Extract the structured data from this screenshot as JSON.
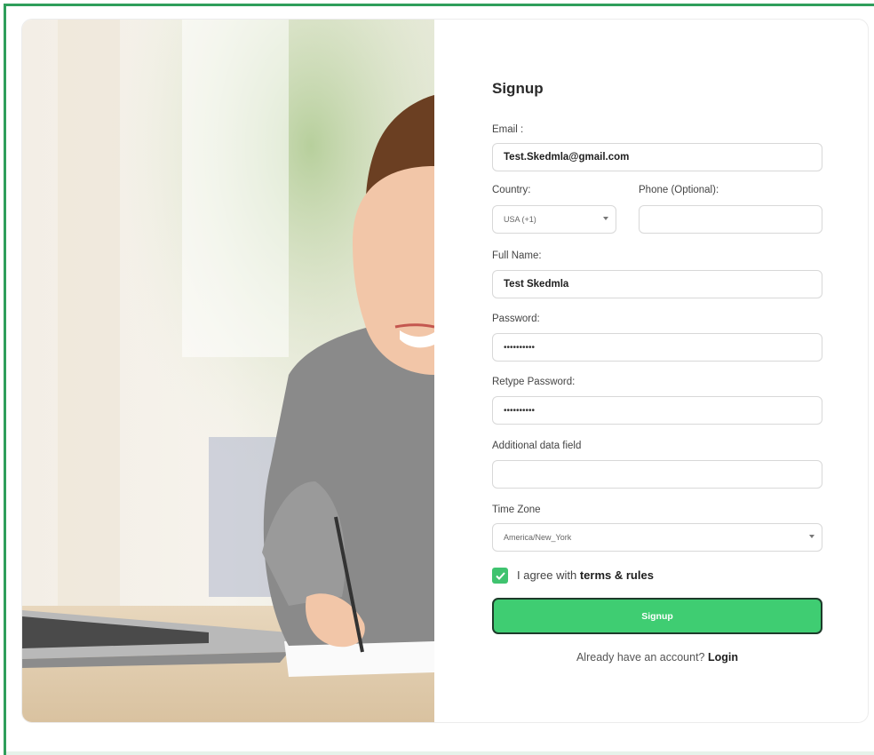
{
  "form": {
    "title": "Signup",
    "email_label": "Email :",
    "email_value": "Test.Skedmla@gmail.com",
    "country_label": "Country:",
    "country_value": "USA (+1)",
    "phone_label": "Phone (Optional):",
    "phone_value": "",
    "fullname_label": "Full Name:",
    "fullname_value": "Test Skedmla",
    "password_label": "Password:",
    "password_value": "••••••••••",
    "retype_label": "Retype Password:",
    "retype_value": "••••••••••",
    "additional_label": "Additional data field",
    "additional_value": "",
    "timezone_label": "Time Zone",
    "timezone_value": "America/New_York",
    "agree_prefix": "I agree with",
    "agree_link": "terms & rules",
    "agree_checked": true,
    "signup_button": "Signup",
    "already_text": "Already have an account?",
    "login_link": "Login"
  },
  "icons": {
    "checkbox": "check-icon",
    "dropdown": "chevron-down-icon"
  },
  "colors": {
    "accent": "#3fcd72",
    "frame": "#2f9e5b",
    "button_border": "#1d3b2a"
  }
}
